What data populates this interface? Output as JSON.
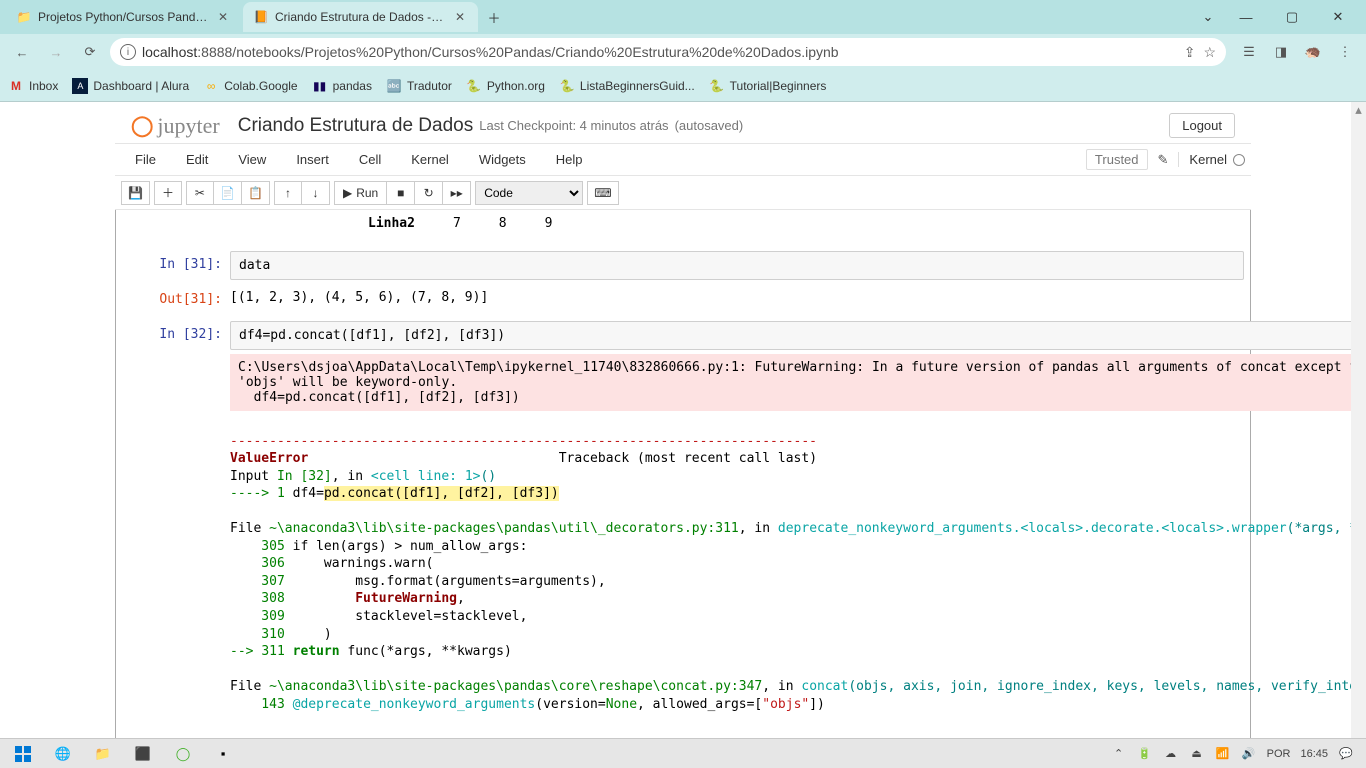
{
  "tabs": [
    {
      "title": "Projetos Python/Cursos Pandas/"
    },
    {
      "title": "Criando Estrutura de Dados - Jup"
    }
  ],
  "url": {
    "host": "localhost",
    "rest": ":8888/notebooks/Projetos%20Python/Cursos%20Pandas/Criando%20Estrutura%20de%20Dados.ipynb"
  },
  "bookmarks": [
    "Inbox",
    "Dashboard | Alura",
    "Colab.Google",
    "pandas",
    "Tradutor",
    "Python.org",
    "ListaBeginnersGuid...",
    "Tutorial|Beginners"
  ],
  "jupyter": {
    "logo": "jupyter",
    "title": "Criando Estrutura de Dados",
    "checkpoint": "Last Checkpoint: 4 minutos atrás",
    "autosaved": "(autosaved)",
    "logout": "Logout",
    "trusted": "Trusted",
    "kernel": "Kernel"
  },
  "menus": [
    "File",
    "Edit",
    "View",
    "Insert",
    "Cell",
    "Kernel",
    "Widgets",
    "Help"
  ],
  "toolbar": {
    "run": "Run",
    "mode": "Code"
  },
  "df_snip": {
    "row": "Linha2",
    "c1": "7",
    "c2": "8",
    "c3": "9"
  },
  "cells": {
    "c31": {
      "in": "In [31]:",
      "code": "data",
      "out": "Out[31]:",
      "result": "[(1, 2, 3), (4, 5, 6), (7, 8, 9)]"
    },
    "c32": {
      "in": "In [32]:",
      "code": "df4=pd.concat([df1], [df2], [df3])"
    }
  },
  "warn": "C:\\Users\\dsjoa\\AppData\\Local\\Temp\\ipykernel_11740\\832860666.py:1: FutureWarning: In a future version of pandas all arguments of concat except for the argument 'objs' will be keyword-only.\n  df4=pd.concat([df1], [df2], [df3])",
  "trace": {
    "dash": "---------------------------------------------------------------------------",
    "err": "ValueError",
    "tb": "                                Traceback (most recent call last)",
    "inputline_a": "Input ",
    "inputline_b": "In [32]",
    "inputline_c": ", in ",
    "inputline_d": "<cell line: 1>",
    "inputline_e": "()",
    "arrow": "----> 1 ",
    "arrow_code_a": "df4=",
    "arrow_code_b": "pd.concat([df1], [df2], [df3])",
    "file1_a": "File ",
    "file1_b": "~\\anaconda3\\lib\\site-packages\\pandas\\util\\_decorators.py:311",
    "file1_c": ", in ",
    "file1_d": "deprecate_nonkeyword_arguments.<locals>.decorate.<locals>.wrapper",
    "file1_e": "(*args, **kwargs)",
    "l305": "    305 if len(args) > num_allow_args:",
    "l306": "    306     warnings.warn(",
    "l307": "    307         msg.format(arguments=arguments),",
    "l308_a": "    308         ",
    "l308_b": "FutureWarning",
    "l308_c": ",",
    "l309": "    309         stacklevel=stacklevel,",
    "l310": "    310     )",
    "l311_a": "--> ",
    "l311_b": "311",
    "l311_c": " return",
    "l311_d": " func(*args, **kwargs)",
    "file2_a": "File ",
    "file2_b": "~\\anaconda3\\lib\\site-packages\\pandas\\core\\reshape\\concat.py:347",
    "file2_c": ", in ",
    "file2_d": "concat",
    "file2_e": "(objs, axis, join, ignore_index, keys, levels, names, verify_integrity, sort, copy)",
    "l143_a": "    143 ",
    "l143_b": "@deprecate_nonkeyword_arguments",
    "l143_c": "(version=",
    "l143_d": "None",
    "l143_e": ", allowed_args=[",
    "l143_f": "\"objs\"",
    "l143_g": "])"
  },
  "taskbar": {
    "lang": "POR",
    "time": "16:45"
  }
}
